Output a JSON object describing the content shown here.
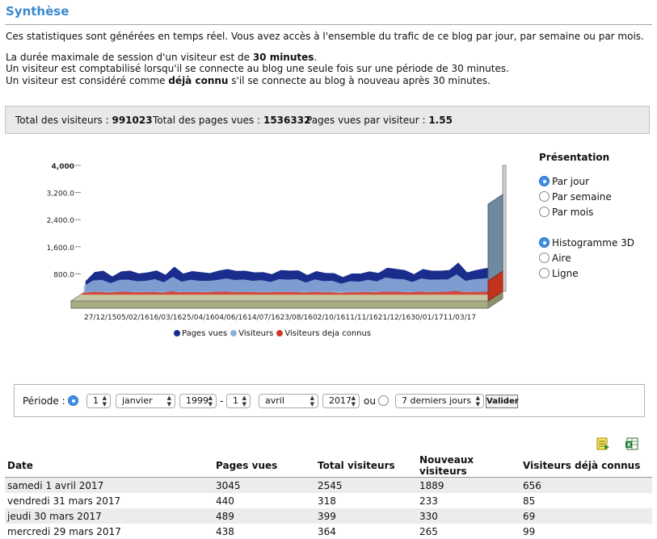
{
  "page": {
    "title": "Synthèse",
    "intro": {
      "line1": "Ces statistiques sont générées en temps réel. Vous avez accès à l'ensemble du trafic de ce blog par jour, par semaine ou par mois.",
      "line2_prefix": "La durée maximale de session d'un visiteur est de ",
      "line2_value": "30 minutes",
      "line2_suffix": ".",
      "line3": "Un visiteur est comptabilisé lorsqu'il se connecte au blog une seule fois sur une période de 30 minutes.",
      "line4_prefix": "Un visiteur est considéré comme ",
      "line4_bold": "déjà connu",
      "line4_suffix": " s'il se connecte au blog à nouveau après 30 minutes."
    }
  },
  "totals": {
    "visitors_label": "Total des visiteurs : ",
    "visitors_value": "991023",
    "pages_label": "Total des pages vues : ",
    "pages_value": "1536332",
    "ratio_label": "Pages vues par visiteur : ",
    "ratio_value": "1.55"
  },
  "chart_data": {
    "type": "area",
    "style": "3d",
    "y_ticks": [
      "4,000",
      "3,200.0",
      "2,400.0",
      "1,600.0",
      "800.0"
    ],
    "ylim": [
      0,
      4000
    ],
    "x_tick_labels": [
      "27/12/15",
      "05/02/16",
      "16/03/16",
      "25/04/16",
      "04/06/16",
      "14/07/16",
      "23/08/16",
      "02/10/16",
      "11/11/16",
      "21/12/16",
      "30/01/17",
      "11/03/17"
    ],
    "x_ticks_text": "27/12/1505/02/1616/03/1625/04/1604/06/1614/07/1623/08/1602/10/1611/11/1621/12/1630/01/1711/03/17",
    "series": [
      {
        "name": "Pages vues",
        "color": "#1a2d8c",
        "values": [
          300,
          650,
          600,
          500,
          580,
          700,
          520,
          640,
          610,
          560,
          720,
          600,
          590,
          650,
          530,
          700,
          650,
          690,
          600,
          640,
          560,
          580,
          620,
          700,
          610,
          550,
          590,
          620,
          530,
          480,
          520,
          600,
          580,
          620,
          690,
          760,
          620,
          580,
          650,
          700,
          600,
          720,
          840,
          640,
          620,
          780,
          700,
          3045
        ]
      },
      {
        "name": "Visiteurs",
        "color": "#8fb1de",
        "values": [
          200,
          430,
          380,
          340,
          380,
          460,
          340,
          420,
          400,
          370,
          470,
          390,
          380,
          420,
          350,
          450,
          420,
          450,
          390,
          420,
          370,
          380,
          400,
          460,
          400,
          360,
          390,
          410,
          350,
          320,
          340,
          390,
          380,
          400,
          450,
          490,
          400,
          380,
          420,
          460,
          390,
          470,
          540,
          420,
          400,
          500,
          450,
          2545
        ]
      },
      {
        "name": "Visiteurs deja connus",
        "color": "#d9342b",
        "values": [
          40,
          80,
          70,
          60,
          70,
          90,
          60,
          80,
          70,
          60,
          90,
          70,
          70,
          80,
          60,
          90,
          80,
          80,
          70,
          80,
          60,
          70,
          70,
          80,
          70,
          60,
          70,
          70,
          60,
          50,
          60,
          70,
          70,
          70,
          80,
          90,
          70,
          70,
          80,
          80,
          70,
          90,
          100,
          80,
          70,
          90,
          80,
          656
        ]
      }
    ],
    "legend_placement": "bottom"
  },
  "presentation": {
    "title": "Présentation",
    "period_options": [
      {
        "label": "Par jour",
        "selected": true
      },
      {
        "label": "Par semaine",
        "selected": false
      },
      {
        "label": "Par mois",
        "selected": false
      }
    ],
    "chart_options": [
      {
        "label": "Histogramme 3D",
        "selected": true
      },
      {
        "label": "Aire",
        "selected": false
      },
      {
        "label": "Ligne",
        "selected": false
      }
    ]
  },
  "period_form": {
    "label": "Période :",
    "from_day": "1",
    "from_month": "janvier",
    "from_year": "1999",
    "dash": "-",
    "to_day": "1",
    "to_month": "avril",
    "to_year": "2017",
    "or": "ou",
    "preset": "7 derniers jours",
    "submit": "Valider"
  },
  "export": {
    "icon1": "export-document-icon",
    "icon2": "export-excel-icon"
  },
  "table": {
    "headers": [
      "Date",
      "Pages vues",
      "Total visiteurs",
      "Nouveaux visiteurs",
      "Visiteurs déjà connus"
    ],
    "rows": [
      [
        "samedi 1 avril 2017",
        "3045",
        "2545",
        "1889",
        "656"
      ],
      [
        "vendredi 31 mars 2017",
        "440",
        "318",
        "233",
        "85"
      ],
      [
        "jeudi 30 mars 2017",
        "489",
        "399",
        "330",
        "69"
      ],
      [
        "mercredi 29 mars 2017",
        "438",
        "364",
        "265",
        "99"
      ]
    ]
  }
}
